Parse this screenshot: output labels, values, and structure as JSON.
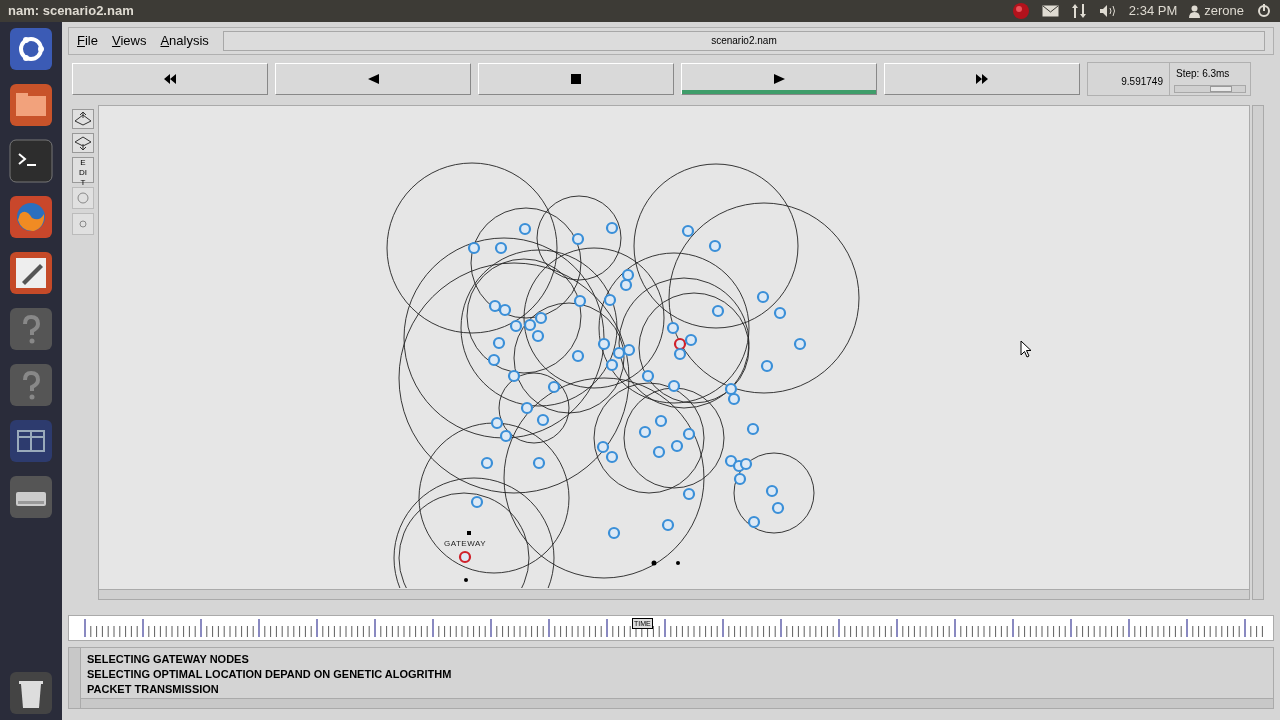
{
  "top_panel": {
    "title": "nam: scenario2.nam",
    "clock": "2:34 PM",
    "user": "zerone"
  },
  "launcher": {
    "items": [
      {
        "kind": "dash"
      },
      {
        "kind": "folder"
      },
      {
        "kind": "terminal"
      },
      {
        "kind": "browser"
      },
      {
        "kind": "editor"
      },
      {
        "kind": "help"
      },
      {
        "kind": "help"
      },
      {
        "kind": "workspace"
      },
      {
        "kind": "drive"
      },
      {
        "kind": "trash"
      }
    ]
  },
  "menu": [
    "File",
    "Views",
    "Analysis"
  ],
  "file_name": "scenario2.nam",
  "playback": [
    {
      "kind": "rewind",
      "selected": false
    },
    {
      "kind": "back",
      "selected": false
    },
    {
      "kind": "stop",
      "selected": false
    },
    {
      "kind": "play",
      "selected": true
    },
    {
      "kind": "forward",
      "selected": false
    }
  ],
  "time": "9.591749",
  "step": {
    "label": "Step: 6.3ms",
    "level": 0.72
  },
  "edit_tools": {
    "edit_label": "EDIT"
  },
  "nodes": [
    {
      "kind": "sensor"
    },
    {
      "kind": "sensor"
    },
    {
      "kind": "sensor"
    },
    {
      "kind": "sensor"
    },
    {
      "kind": "sensor"
    },
    {
      "kind": "sensor"
    },
    {
      "kind": "sensor"
    },
    {
      "kind": "sensor"
    },
    {
      "kind": "sensor"
    },
    {
      "kind": "sensor"
    },
    {
      "kind": "sensor"
    },
    {
      "kind": "sensor"
    },
    {
      "kind": "sensor"
    },
    {
      "kind": "sensor"
    },
    {
      "kind": "sensor"
    },
    {
      "kind": "sensor"
    },
    {
      "kind": "sensor"
    },
    {
      "kind": "sensor"
    },
    {
      "kind": "sensor"
    },
    {
      "kind": "sensor"
    },
    {
      "kind": "sensor"
    },
    {
      "kind": "sensor"
    },
    {
      "kind": "sensor"
    },
    {
      "kind": "sensor"
    },
    {
      "kind": "sensor"
    },
    {
      "kind": "sensor"
    },
    {
      "kind": "sensor"
    },
    {
      "kind": "sensor"
    },
    {
      "kind": "sensor"
    },
    {
      "kind": "sensor"
    },
    {
      "kind": "sensor"
    },
    {
      "kind": "gateway"
    },
    {
      "kind": "sensor"
    },
    {
      "kind": "sensor"
    },
    {
      "kind": "sensor"
    },
    {
      "kind": "sensor"
    },
    {
      "kind": "sensor"
    },
    {
      "kind": "sensor"
    },
    {
      "kind": "sensor"
    },
    {
      "kind": "sensor"
    },
    {
      "kind": "sensor"
    },
    {
      "kind": "sensor"
    },
    {
      "kind": "sensor"
    },
    {
      "kind": "sensor"
    },
    {
      "kind": "sensor"
    },
    {
      "kind": "sensor"
    },
    {
      "kind": "sensor"
    },
    {
      "kind": "sensor"
    },
    {
      "kind": "sensor"
    },
    {
      "kind": "sensor"
    },
    {
      "kind": "sensor"
    },
    {
      "kind": "sensor"
    },
    {
      "kind": "sensor"
    },
    {
      "kind": "sensor"
    },
    {
      "kind": "sensor"
    },
    {
      "kind": "sensor"
    },
    {
      "kind": "sensor"
    },
    {
      "kind": "sensor"
    },
    {
      "kind": "sensor"
    },
    {
      "kind": "sensor"
    },
    {
      "kind": "sensor"
    },
    {
      "kind": "sensor"
    },
    {
      "kind": "sensor"
    },
    {
      "kind": "sensor"
    },
    {
      "kind": "gateway",
      "label": "GATEWAY"
    }
  ],
  "timeline": {
    "marker": "TIME"
  },
  "messages": [
    "SELECTING GATEWAY NODES",
    "SELECTING OPTIMAL LOCATION DEPAND ON GENETIC ALOGRITHM",
    "PACKET TRANSMISSION"
  ]
}
